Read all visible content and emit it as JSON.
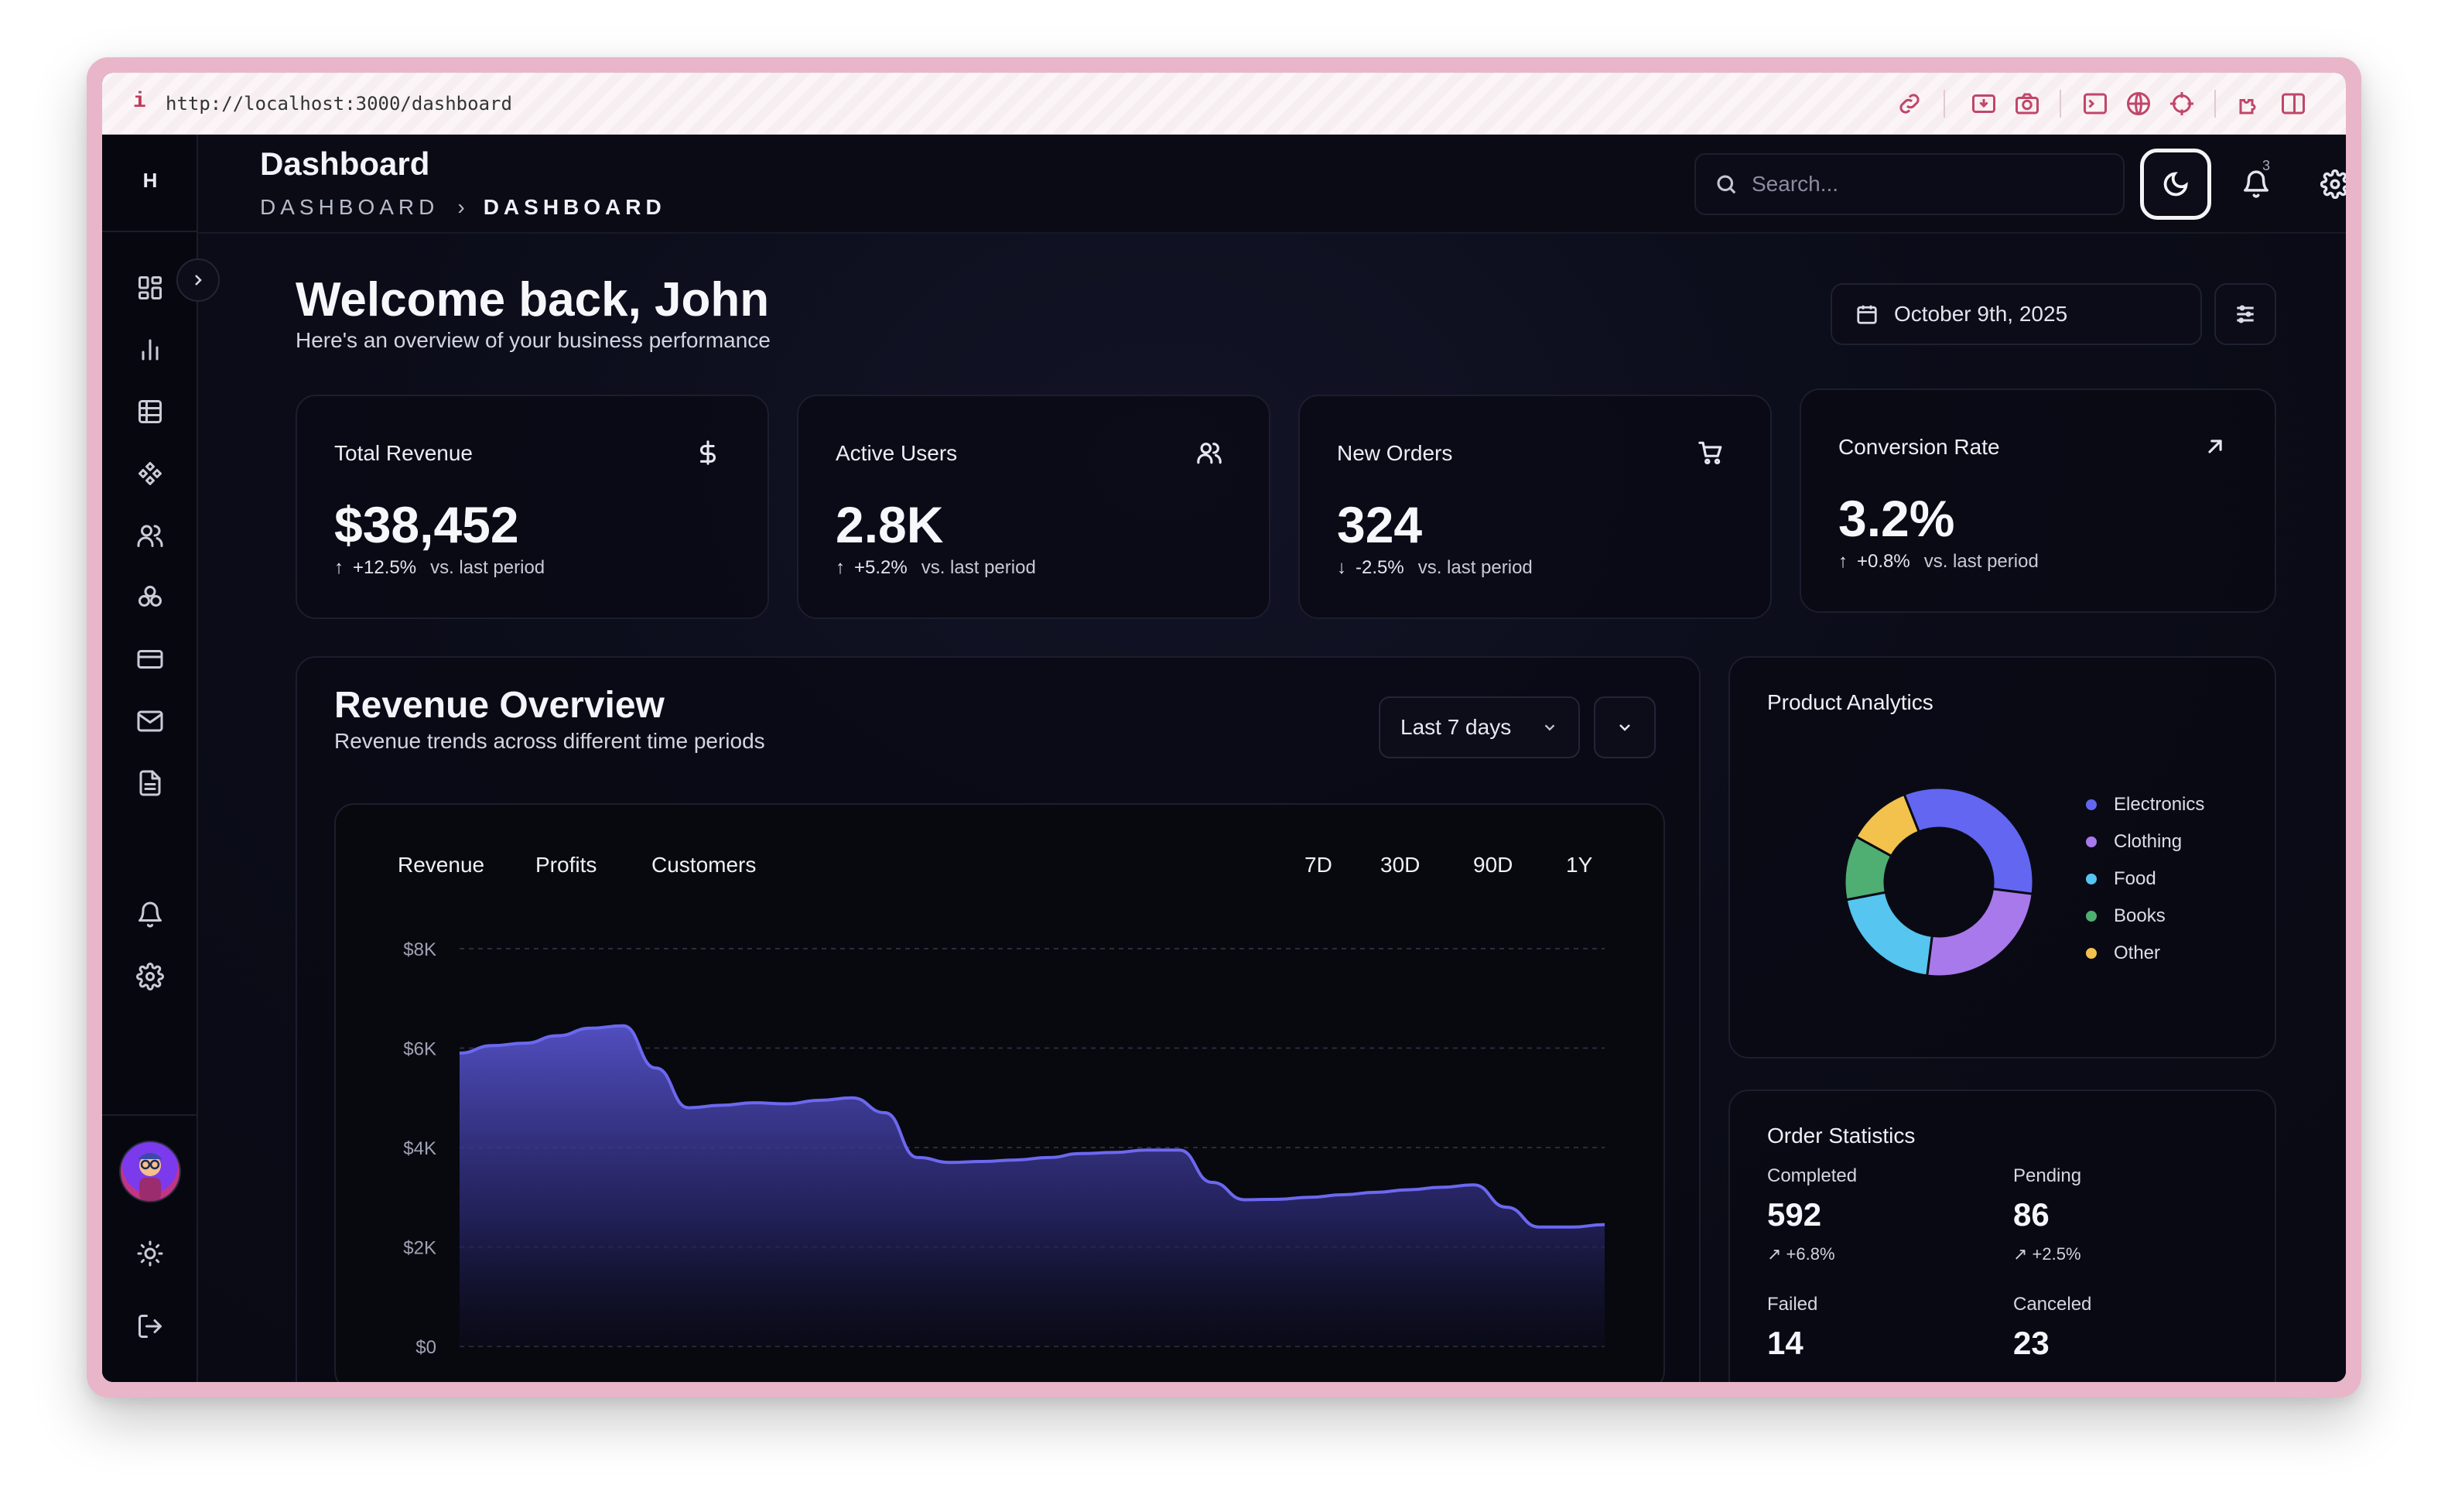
{
  "browser": {
    "url": "http://localhost:3000/dashboard",
    "info_glyph": "i"
  },
  "sidebar": {
    "brand": "H",
    "nav_icons": [
      "dashboard-icon",
      "bar-chart-icon",
      "table-icon",
      "components-icon",
      "users-icon",
      "integrations-icon",
      "credit-card-icon",
      "mail-icon",
      "document-icon"
    ],
    "bottom_icons": [
      "bell-icon",
      "gear-icon"
    ],
    "footer_icons": [
      "sun-icon",
      "logout-icon"
    ]
  },
  "header": {
    "title": "Dashboard",
    "breadcrumb": [
      "DASHBOARD",
      "DASHBOARD"
    ],
    "breadcrumb_separator": "›",
    "search_placeholder": "Search...",
    "notification_count": "3"
  },
  "welcome": {
    "title": "Welcome back, John",
    "subtitle": "Here's an overview of your business performance",
    "date": "October 9th, 2025"
  },
  "stats": [
    {
      "label": "Total Revenue",
      "icon": "dollar-icon",
      "value": "$38,452",
      "arrow": "↑",
      "delta": "+12.5%",
      "vs": "vs. last period"
    },
    {
      "label": "Active Users",
      "icon": "users-icon",
      "value": "2.8K",
      "arrow": "↑",
      "delta": "+5.2%",
      "vs": "vs. last period"
    },
    {
      "label": "New Orders",
      "icon": "cart-icon",
      "value": "324",
      "arrow": "↓",
      "delta": "-2.5%",
      "vs": "vs. last period"
    },
    {
      "label": "Conversion Rate",
      "icon": "arrow-up-right-icon",
      "value": "3.2%",
      "arrow": "↑",
      "delta": "+0.8%",
      "vs": "vs. last period"
    }
  ],
  "revenue_overview": {
    "title": "Revenue Overview",
    "subtitle": "Revenue trends across different time periods",
    "range": "Last 7 days",
    "tabs": [
      "Revenue",
      "Profits",
      "Customers"
    ],
    "periods": [
      "7D",
      "30D",
      "90D",
      "1Y"
    ]
  },
  "chart_data": {
    "type": "area",
    "title": "",
    "xlabel": "",
    "ylabel": "",
    "y_ticks": [
      "$8K",
      "$6K",
      "$4K",
      "$2K",
      "$0"
    ],
    "ylim": [
      0,
      8000
    ],
    "grid": true,
    "color": "#5b57d6",
    "values": [
      5900,
      6050,
      6100,
      6250,
      6400,
      6450,
      5600,
      4800,
      4850,
      4900,
      4880,
      4950,
      5000,
      4700,
      3800,
      3700,
      3720,
      3750,
      3800,
      3880,
      3900,
      3950,
      3950,
      3300,
      2950,
      2960,
      3000,
      3050,
      3100,
      3150,
      3200,
      3250,
      2800,
      2400,
      2400,
      2450
    ]
  },
  "product_analytics": {
    "title": "Product Analytics",
    "chart_data": {
      "type": "pie",
      "slices": [
        {
          "label": "Electronics",
          "value": 33,
          "color": "#6366f1"
        },
        {
          "label": "Clothing",
          "value": 25,
          "color": "#a879ea"
        },
        {
          "label": "Food",
          "value": 20,
          "color": "#56c5ef"
        },
        {
          "label": "Books",
          "value": 11,
          "color": "#4fae72"
        },
        {
          "label": "Other",
          "value": 11,
          "color": "#f2c24c"
        }
      ]
    }
  },
  "order_statistics": {
    "title": "Order Statistics",
    "cells": [
      {
        "label": "Completed",
        "value": "592",
        "delta": "↗ +6.8%"
      },
      {
        "label": "Pending",
        "value": "86",
        "delta": "↗ +2.5%"
      },
      {
        "label": "Failed",
        "value": "14",
        "delta": ""
      },
      {
        "label": "Canceled",
        "value": "23",
        "delta": ""
      }
    ]
  }
}
